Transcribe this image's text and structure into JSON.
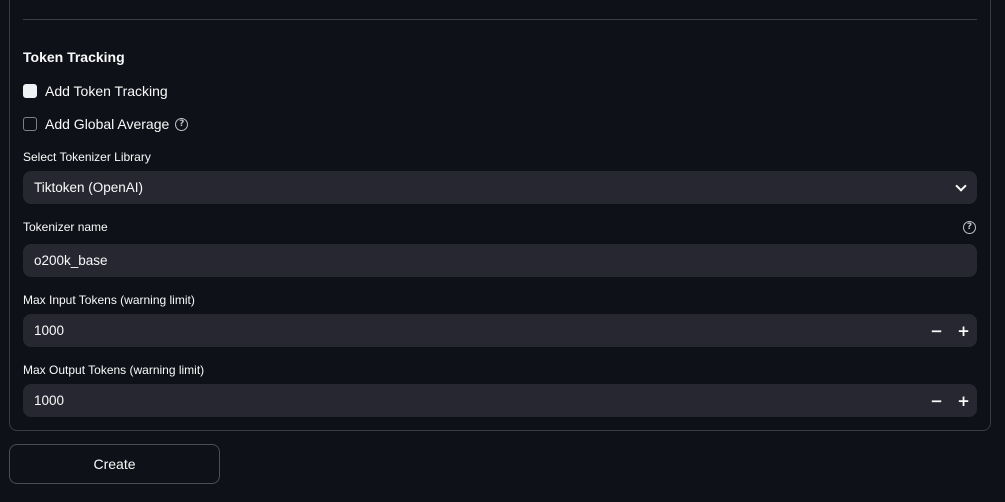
{
  "token_tracking": {
    "title": "Token Tracking",
    "add_token_tracking_label": "Add Token Tracking",
    "add_global_average_label": "Add Global Average"
  },
  "tokenizer_library": {
    "label": "Select Tokenizer Library",
    "selected": "Tiktoken (OpenAI)"
  },
  "tokenizer_name": {
    "label": "Tokenizer name",
    "value": "o200k_base"
  },
  "max_input_tokens": {
    "label": "Max Input Tokens (warning limit)",
    "value": "1000",
    "decrement": "−",
    "increment": "+"
  },
  "max_output_tokens": {
    "label": "Max Output Tokens (warning limit)",
    "value": "1000",
    "decrement": "−",
    "increment": "+"
  },
  "create_button": {
    "label": "Create"
  },
  "icons": {
    "help": "?"
  },
  "colors": {
    "background": "#0e1117",
    "field_bg": "#262730",
    "text": "#fafafa",
    "border": "#3a3d45"
  }
}
